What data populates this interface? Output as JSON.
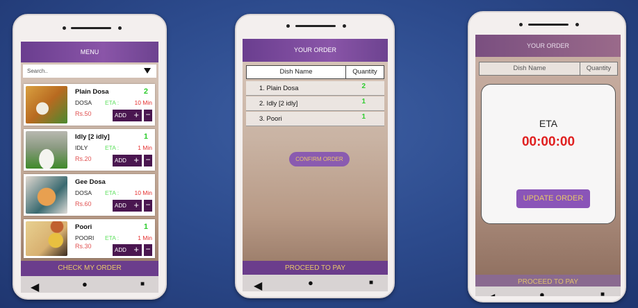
{
  "menu_screen": {
    "header": "MENU",
    "search_placeholder": "Search..",
    "items": [
      {
        "name": "Plain Dosa",
        "qty": "2",
        "category": "DOSA",
        "eta_label": "ETA :",
        "eta": "10 Min",
        "price": "Rs.50",
        "add": "ADD",
        "plus": "+",
        "minus": "−"
      },
      {
        "name": "Idly   [2 idly]",
        "qty": "1",
        "category": "IDLY",
        "eta_label": "ETA :",
        "eta": "1 Min",
        "price": "Rs.20",
        "add": "ADD",
        "plus": "+",
        "minus": "−"
      },
      {
        "name": "Gee Dosa",
        "qty": "",
        "category": "DOSA",
        "eta_label": "ETA :",
        "eta": "10 Min",
        "price": "Rs.60",
        "add": "ADD",
        "plus": "+",
        "minus": "−"
      },
      {
        "name": "Poori",
        "qty": "1",
        "category": "POORI",
        "eta_label": "ETA :",
        "eta": "1 Min",
        "price": "Rs.30",
        "add": "ADD",
        "plus": "+",
        "minus": "−"
      }
    ],
    "check_order": "CHECK MY ORDER"
  },
  "order_screen": {
    "header": "YOUR ORDER",
    "columns": [
      "Dish Name",
      "Quantity"
    ],
    "rows": [
      {
        "name": "1. Plain Dosa",
        "qty": "2"
      },
      {
        "name": "2. Idly   [2 idly]",
        "qty": "1"
      },
      {
        "name": "3. Poori",
        "qty": "1"
      }
    ],
    "confirm": "CONFIRM ORDER",
    "proceed": "PROCEED TO PAY"
  },
  "eta_screen": {
    "header": "YOUR ORDER",
    "columns": [
      "Dish Name",
      "Quantity"
    ],
    "eta_label": "ETA",
    "timer": "00:00:00",
    "update": "UPDATE ORDER",
    "proceed": "PROCEED TO PAY"
  },
  "nav": {
    "back": "◀",
    "home": "●",
    "recent": "■"
  }
}
